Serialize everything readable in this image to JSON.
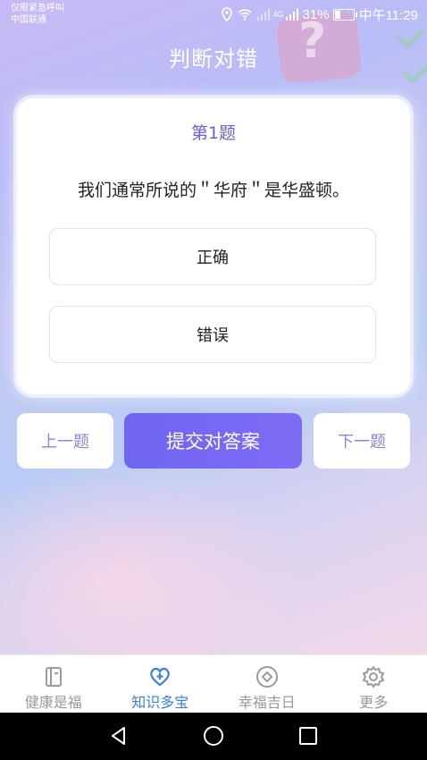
{
  "status_bar": {
    "carrier_line1": "仅限紧急呼叫",
    "carrier_line2": "中国联通",
    "network": "4G",
    "battery": "31%",
    "time": "中午11:29"
  },
  "page_title": "判断对错",
  "question": {
    "number": "第1题",
    "text": "我们通常所说的＂华府＂是华盛顿。",
    "options": [
      "正确",
      "错误"
    ]
  },
  "buttons": {
    "prev": "上一题",
    "submit": "提交对答案",
    "next": "下一题"
  },
  "tabs": [
    {
      "label": "健康是福",
      "icon": "book-icon",
      "active": false
    },
    {
      "label": "知识多宝",
      "icon": "heart-plus-icon",
      "active": true
    },
    {
      "label": "幸福吉日",
      "icon": "diamond-circle-icon",
      "active": false
    },
    {
      "label": "更多",
      "icon": "gear-icon",
      "active": false
    }
  ],
  "colors": {
    "accent": "#6f66f2",
    "active_tab": "#3d7de0",
    "inactive_tab": "#999999"
  }
}
